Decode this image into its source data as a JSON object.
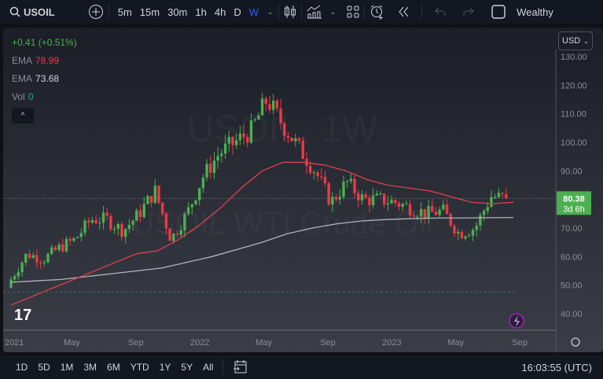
{
  "topbar": {
    "symbol": "USOIL",
    "intervals": [
      "5m",
      "15m",
      "30m",
      "1h",
      "4h",
      "D",
      "W"
    ],
    "active_interval": "W",
    "account": "Wealthy"
  },
  "legend": {
    "change": "+0.41 (+0.51%)",
    "ema1_label": "EMA",
    "ema1_value": "78.99",
    "ema2_label": "EMA",
    "ema2_value": "73.68",
    "vol_label": "Vol",
    "vol_value": "0"
  },
  "currency": "USD",
  "watermark": {
    "line1": "USOIL, 1W",
    "line2": "USOIL WTI Crude Oil"
  },
  "price_tag": {
    "price": "80.38",
    "countdown": "3d 6h"
  },
  "bottombar": {
    "ranges": [
      "1D",
      "5D",
      "1M",
      "3M",
      "6M",
      "YTD",
      "1Y",
      "5Y",
      "All"
    ],
    "time": "16:03:55 (UTC)"
  },
  "colors": {
    "up": "#4caf50",
    "down": "#f23645",
    "ema_fast": "#e0404f",
    "ema_slow": "#b2b5be",
    "accent": "#2962ff",
    "tag": "#4caf50"
  },
  "chart_data": {
    "type": "candlestick",
    "title": "USOIL, 1W",
    "ylim": [
      35,
      132
    ],
    "y_ticks": [
      "130.00",
      "120.00",
      "110.00",
      "100.00",
      "90.00",
      "80.00",
      "70.00",
      "60.00",
      "50.00",
      "40.00"
    ],
    "x_ticks": [
      "2021",
      "May",
      "Sep",
      "2022",
      "May",
      "Sep",
      "2023",
      "May",
      "Sep"
    ],
    "monthly_closes": [
      52,
      61,
      59,
      63,
      66,
      73,
      73,
      69,
      75,
      83,
      66,
      75,
      88,
      96,
      100,
      104,
      115,
      106,
      98,
      90,
      79,
      86,
      80,
      80,
      79,
      77,
      75,
      76,
      68,
      70,
      81,
      80.38
    ],
    "ema_fast_monthly": [
      43,
      46,
      49,
      52,
      55,
      58,
      61,
      62,
      66,
      71,
      77,
      84,
      90,
      93,
      93,
      92,
      90,
      87,
      85,
      84,
      83,
      81,
      79,
      78.5,
      78.99
    ],
    "ema_slow_monthly": [
      51,
      51.5,
      52,
      53,
      54,
      55,
      56,
      58,
      60,
      62.5,
      65,
      68,
      70,
      71.5,
      72.5,
      73,
      73.3,
      73.5,
      73.5,
      73.6,
      73.68
    ],
    "last_price": 80.38,
    "dashed_level": 47.5
  }
}
